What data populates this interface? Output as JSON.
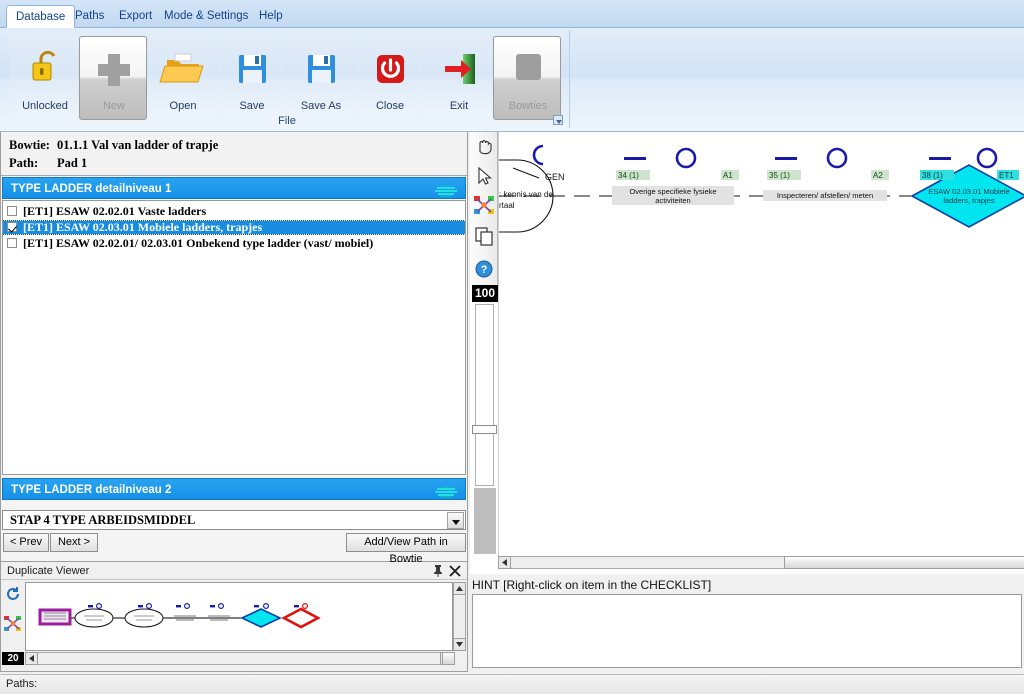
{
  "menu": {
    "tabs": [
      {
        "label": "Database",
        "active": true
      },
      {
        "label": "Paths",
        "active": false
      },
      {
        "label": "Export",
        "active": false
      },
      {
        "label": "Mode & Settings",
        "active": false
      },
      {
        "label": "Help",
        "active": false
      }
    ]
  },
  "ribbon": {
    "group_label": "File",
    "buttons": [
      {
        "label": "Unlocked",
        "icon": "padlock-open-icon",
        "state": "normal"
      },
      {
        "label": "New",
        "icon": "plus-icon",
        "state": "disabled"
      },
      {
        "label": "Open",
        "icon": "folder-open-icon",
        "state": "normal"
      },
      {
        "label": "Save",
        "icon": "floppy-disk-icon",
        "state": "normal"
      },
      {
        "label": "Save As",
        "icon": "floppy-disk-icon",
        "state": "normal"
      },
      {
        "label": "Close",
        "icon": "power-icon",
        "state": "normal"
      },
      {
        "label": "Exit",
        "icon": "exit-arrow-icon",
        "state": "normal"
      },
      {
        "label": "Bowties",
        "icon": "bowties-icon",
        "state": "disabled"
      }
    ]
  },
  "left_panel": {
    "bowtie_label": "Bowtie:",
    "bowtie_value": "01.1.1 Val van ladder of trapje",
    "path_label": "Path:",
    "path_value": "Pad 1",
    "section1_title": "TYPE LADDER detailniveau 1",
    "section2_title": "TYPE LADDER detailniveau 2",
    "checklist": [
      {
        "label": "[ET1] ESAW 02.02.01 Vaste ladders",
        "checked": false,
        "selected": false
      },
      {
        "label": "[ET1] ESAW 02.03.01 Mobiele ladders, trapjes",
        "checked": true,
        "selected": true
      },
      {
        "label": "[ET1] ESAW 02.02.01/ 02.03.01 Onbekend type ladder (vast/ mobiel)",
        "checked": false,
        "selected": false
      }
    ],
    "step_combo_value": "STAP 4 TYPE ARBEIDSMIDDEL",
    "prev_button": "< Prev",
    "next_button": "Next >",
    "add_view_button": "Add/View Path in Bowtie"
  },
  "duplicate_viewer": {
    "title": "Duplicate Viewer",
    "pin_icon": "pin-icon",
    "close_icon": "close-icon",
    "refresh_icon": "refresh-icon",
    "colors_icon": "color-scissors-icon",
    "zoom_value": "20"
  },
  "diagram": {
    "tools": [
      {
        "name": "hand-pan-icon"
      },
      {
        "name": "arrow-select-icon"
      },
      {
        "name": "color-scissors-icon"
      },
      {
        "name": "copy-icon"
      },
      {
        "name": "help-icon"
      }
    ],
    "zoom_value": "100",
    "gate_label": "GEN",
    "gate_text_line1": "kennis van de",
    "gate_text_line2": "rtaal",
    "nodes": [
      {
        "code": "34 (1)",
        "tag": "A1",
        "text": "Overige specifieke fysieke activiteiten",
        "shape": "line-circle",
        "accent": "#1a1aaa"
      },
      {
        "code": "35 (1)",
        "tag": "A2",
        "text": "Inspecteren/ afstellen/ meten",
        "shape": "line-circle",
        "accent": "#1a1aaa"
      },
      {
        "code": "38 (1)",
        "tag": "ET1",
        "text": "ESAW 02.03.01 Mobiele ladders, trapjes",
        "shape": "diamond",
        "accent": "#00e5ee"
      }
    ]
  },
  "hint": {
    "text": "HINT [Right-click on item in the CHECKLIST]"
  },
  "status": {
    "text": "Paths:"
  },
  "colors": {
    "section_header_blue": "#1490e8",
    "selection_blue": "#1a8ce0",
    "diamond_cyan": "#00e5ee",
    "node_blue": "#1a1aaa",
    "ribbon_blue": "#c9dcf0"
  }
}
